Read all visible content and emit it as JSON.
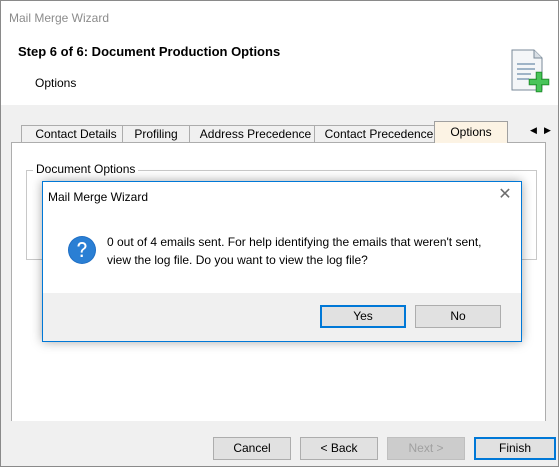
{
  "window": {
    "title": "Mail Merge Wizard"
  },
  "header": {
    "step_title": "Step 6 of 6: Document Production Options",
    "subtitle": "Options",
    "icon": "document-add-icon"
  },
  "tabs": [
    {
      "label": "Contact Details"
    },
    {
      "label": "Profiling"
    },
    {
      "label": "Address Precedence"
    },
    {
      "label": "Contact Precedence"
    },
    {
      "label": "Options",
      "active": true
    }
  ],
  "tab_nav": {
    "prev": "◀",
    "next": "▶"
  },
  "panel": {
    "group_label": "Document Options"
  },
  "footer": {
    "cancel": "Cancel",
    "back": "< Back",
    "next": "Next >",
    "finish": "Finish"
  },
  "dialog": {
    "title": "Mail Merge Wizard",
    "close": "✕",
    "icon": "question-icon",
    "message": "0 out of 4 emails sent. For help identifying the emails that weren't sent, view the log file. Do you want to view the log file?",
    "yes": "Yes",
    "no": "No"
  },
  "colors": {
    "accent": "#0078d7",
    "active_tab": "#fcf3e4",
    "dialog_footer": "#f0f0f0"
  }
}
